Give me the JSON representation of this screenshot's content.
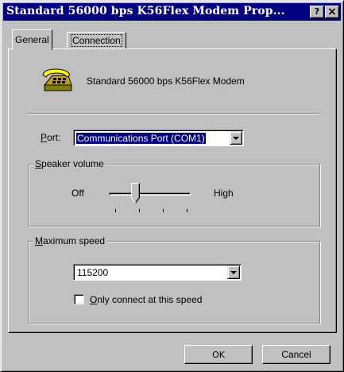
{
  "window": {
    "title": "Standard 56000 bps K56Flex Modem Prop...",
    "help_button": "?",
    "close_button": "×"
  },
  "tabs": [
    {
      "label": "General",
      "selected": true
    },
    {
      "label": "Connection",
      "selected": false
    }
  ],
  "general": {
    "modem_name": "Standard 56000 bps K56Flex Modem",
    "port": {
      "label_mnemonic": "P",
      "label_rest": "ort:",
      "value": "Communications Port (COM1)"
    },
    "speaker_volume": {
      "group_mnemonic": "S",
      "group_rest": "peaker volume",
      "min_label": "Off",
      "max_label": "High",
      "level": 0.33
    },
    "maximum_speed": {
      "group_mnemonic": "M",
      "group_rest": "aximum speed",
      "value": "115200",
      "only_connect_mnemonic": "O",
      "only_connect_rest": "nly connect at this speed",
      "only_connect_checked": false
    }
  },
  "buttons": {
    "ok": "OK",
    "cancel": "Cancel"
  },
  "icons": {
    "modem": "telephone-modem-icon",
    "dropdown": "chevron-down-icon"
  },
  "colors": {
    "titlebar": "#000080",
    "face": "#c0c0c0",
    "selection": "#000080"
  }
}
